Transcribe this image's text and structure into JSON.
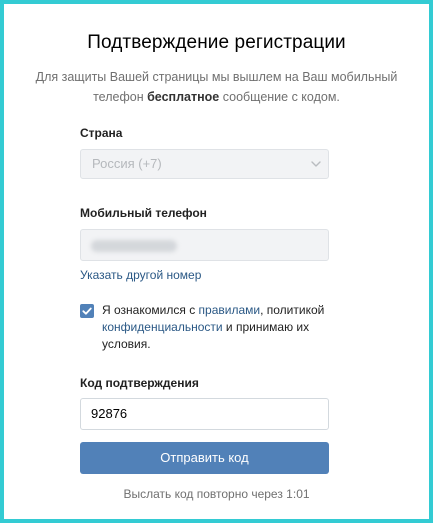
{
  "page": {
    "title": "Подтверждение регистрации",
    "subtitle_part1": "Для защиты Вашей страницы мы вышлем на Ваш мобильный телефон ",
    "subtitle_bold": "бесплатное",
    "subtitle_part2": " сообщение с кодом."
  },
  "country": {
    "label": "Страна",
    "value": "Россия (+7)"
  },
  "phone": {
    "label": "Мобильный телефон",
    "change_link": "Указать другой номер"
  },
  "agreement": {
    "checked": true,
    "text1": "Я ознакомился с ",
    "link_rules": "правилами",
    "text2": ", политикой ",
    "link_privacy": "конфиденциальности",
    "text3": " и принимаю их условия."
  },
  "code": {
    "label": "Код подтверждения",
    "value": "92876"
  },
  "submit": {
    "label": "Отправить код"
  },
  "resend": {
    "text": "Выслать код повторно через 1:01"
  },
  "colors": {
    "frame_border": "#33cbd3",
    "accent_button": "#5181b8",
    "link": "#2a5885"
  }
}
